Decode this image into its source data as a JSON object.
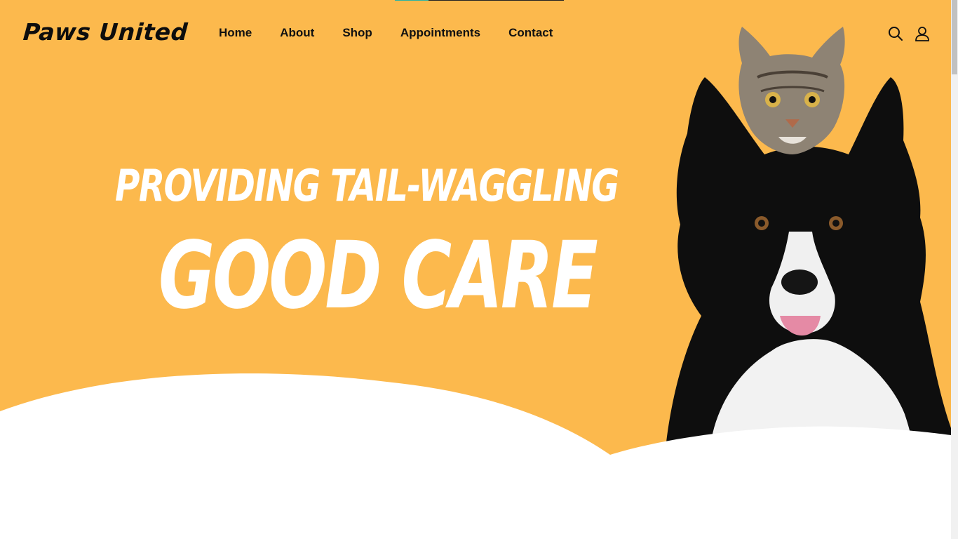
{
  "site": {
    "logo_text": "Paws United"
  },
  "nav": {
    "items": [
      {
        "label": "Home"
      },
      {
        "label": "About"
      },
      {
        "label": "Shop"
      },
      {
        "label": "Appointments"
      },
      {
        "label": "Contact"
      }
    ]
  },
  "header_icons": {
    "search": "search-icon",
    "account": "user-icon"
  },
  "hero": {
    "line1": "PROVIDING TAIL-WAGGLING",
    "line2": "GOOD CARE",
    "image_alt": "cat-and-dog-photo"
  },
  "colors": {
    "hero_bg": "#FCB94D",
    "text_dark": "#111111",
    "hero_text": "#FFFFFF",
    "accent": "#2BB3A3"
  }
}
